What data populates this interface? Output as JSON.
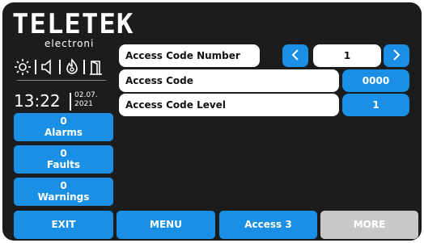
{
  "brand": {
    "name": "TELETEK",
    "tagline": "electroni"
  },
  "status": {
    "time": "13:22",
    "date_line1": "02.07.",
    "date_line2": "2021"
  },
  "counters": [
    {
      "count": "0",
      "label": "Alarms"
    },
    {
      "count": "0",
      "label": "Faults"
    },
    {
      "count": "0",
      "label": "Warnings"
    }
  ],
  "rows": [
    {
      "label": "Access Code Number",
      "value": "1"
    },
    {
      "label": "Access Code",
      "value": "0000"
    },
    {
      "label": "Access Code Level",
      "value": "1"
    }
  ],
  "bottom": {
    "exit": "EXIT",
    "menu": "MENU",
    "access": "Access 3",
    "more": "MORE"
  },
  "colors": {
    "background": "#1c1c1c",
    "accent": "#1a8fe6",
    "disabled": "#c8c8c8"
  },
  "icons": [
    "sun-icon",
    "speaker-icon",
    "fire-icon",
    "door-icon",
    "chevron-left-icon",
    "chevron-right-icon"
  ]
}
